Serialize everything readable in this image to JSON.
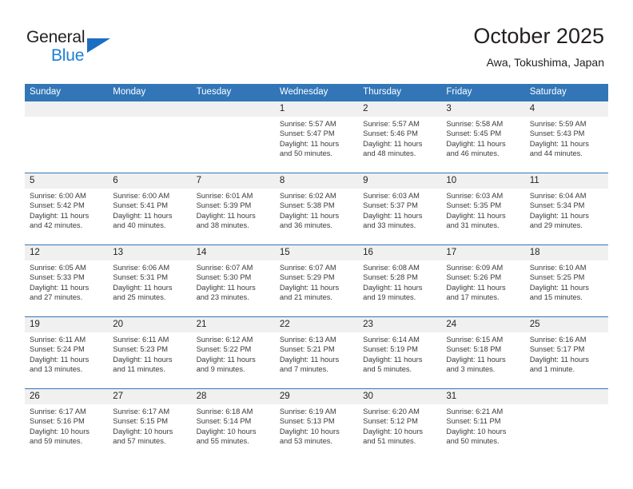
{
  "brand": {
    "name_top": "General",
    "name_bottom": "Blue",
    "triangle_icon": "brand-triangle-icon",
    "color_dark": "#231f20",
    "color_blue": "#1b7fd4"
  },
  "header": {
    "title": "October 2025",
    "subtitle": "Awa, Tokushima, Japan"
  },
  "theme": {
    "header_bg": "#3276b8",
    "date_band_bg": "#f0f0f0",
    "divider": "#3276b8",
    "text": "#231f20"
  },
  "calendar": {
    "weekdays": [
      "Sunday",
      "Monday",
      "Tuesday",
      "Wednesday",
      "Thursday",
      "Friday",
      "Saturday"
    ],
    "weeks": [
      [
        {
          "day": "",
          "sunrise": "",
          "sunset": "",
          "daylight_line1": "",
          "daylight_line2": ""
        },
        {
          "day": "",
          "sunrise": "",
          "sunset": "",
          "daylight_line1": "",
          "daylight_line2": ""
        },
        {
          "day": "",
          "sunrise": "",
          "sunset": "",
          "daylight_line1": "",
          "daylight_line2": ""
        },
        {
          "day": "1",
          "sunrise": "Sunrise: 5:57 AM",
          "sunset": "Sunset: 5:47 PM",
          "daylight_line1": "Daylight: 11 hours",
          "daylight_line2": "and 50 minutes."
        },
        {
          "day": "2",
          "sunrise": "Sunrise: 5:57 AM",
          "sunset": "Sunset: 5:46 PM",
          "daylight_line1": "Daylight: 11 hours",
          "daylight_line2": "and 48 minutes."
        },
        {
          "day": "3",
          "sunrise": "Sunrise: 5:58 AM",
          "sunset": "Sunset: 5:45 PM",
          "daylight_line1": "Daylight: 11 hours",
          "daylight_line2": "and 46 minutes."
        },
        {
          "day": "4",
          "sunrise": "Sunrise: 5:59 AM",
          "sunset": "Sunset: 5:43 PM",
          "daylight_line1": "Daylight: 11 hours",
          "daylight_line2": "and 44 minutes."
        }
      ],
      [
        {
          "day": "5",
          "sunrise": "Sunrise: 6:00 AM",
          "sunset": "Sunset: 5:42 PM",
          "daylight_line1": "Daylight: 11 hours",
          "daylight_line2": "and 42 minutes."
        },
        {
          "day": "6",
          "sunrise": "Sunrise: 6:00 AM",
          "sunset": "Sunset: 5:41 PM",
          "daylight_line1": "Daylight: 11 hours",
          "daylight_line2": "and 40 minutes."
        },
        {
          "day": "7",
          "sunrise": "Sunrise: 6:01 AM",
          "sunset": "Sunset: 5:39 PM",
          "daylight_line1": "Daylight: 11 hours",
          "daylight_line2": "and 38 minutes."
        },
        {
          "day": "8",
          "sunrise": "Sunrise: 6:02 AM",
          "sunset": "Sunset: 5:38 PM",
          "daylight_line1": "Daylight: 11 hours",
          "daylight_line2": "and 36 minutes."
        },
        {
          "day": "9",
          "sunrise": "Sunrise: 6:03 AM",
          "sunset": "Sunset: 5:37 PM",
          "daylight_line1": "Daylight: 11 hours",
          "daylight_line2": "and 33 minutes."
        },
        {
          "day": "10",
          "sunrise": "Sunrise: 6:03 AM",
          "sunset": "Sunset: 5:35 PM",
          "daylight_line1": "Daylight: 11 hours",
          "daylight_line2": "and 31 minutes."
        },
        {
          "day": "11",
          "sunrise": "Sunrise: 6:04 AM",
          "sunset": "Sunset: 5:34 PM",
          "daylight_line1": "Daylight: 11 hours",
          "daylight_line2": "and 29 minutes."
        }
      ],
      [
        {
          "day": "12",
          "sunrise": "Sunrise: 6:05 AM",
          "sunset": "Sunset: 5:33 PM",
          "daylight_line1": "Daylight: 11 hours",
          "daylight_line2": "and 27 minutes."
        },
        {
          "day": "13",
          "sunrise": "Sunrise: 6:06 AM",
          "sunset": "Sunset: 5:31 PM",
          "daylight_line1": "Daylight: 11 hours",
          "daylight_line2": "and 25 minutes."
        },
        {
          "day": "14",
          "sunrise": "Sunrise: 6:07 AM",
          "sunset": "Sunset: 5:30 PM",
          "daylight_line1": "Daylight: 11 hours",
          "daylight_line2": "and 23 minutes."
        },
        {
          "day": "15",
          "sunrise": "Sunrise: 6:07 AM",
          "sunset": "Sunset: 5:29 PM",
          "daylight_line1": "Daylight: 11 hours",
          "daylight_line2": "and 21 minutes."
        },
        {
          "day": "16",
          "sunrise": "Sunrise: 6:08 AM",
          "sunset": "Sunset: 5:28 PM",
          "daylight_line1": "Daylight: 11 hours",
          "daylight_line2": "and 19 minutes."
        },
        {
          "day": "17",
          "sunrise": "Sunrise: 6:09 AM",
          "sunset": "Sunset: 5:26 PM",
          "daylight_line1": "Daylight: 11 hours",
          "daylight_line2": "and 17 minutes."
        },
        {
          "day": "18",
          "sunrise": "Sunrise: 6:10 AM",
          "sunset": "Sunset: 5:25 PM",
          "daylight_line1": "Daylight: 11 hours",
          "daylight_line2": "and 15 minutes."
        }
      ],
      [
        {
          "day": "19",
          "sunrise": "Sunrise: 6:11 AM",
          "sunset": "Sunset: 5:24 PM",
          "daylight_line1": "Daylight: 11 hours",
          "daylight_line2": "and 13 minutes."
        },
        {
          "day": "20",
          "sunrise": "Sunrise: 6:11 AM",
          "sunset": "Sunset: 5:23 PM",
          "daylight_line1": "Daylight: 11 hours",
          "daylight_line2": "and 11 minutes."
        },
        {
          "day": "21",
          "sunrise": "Sunrise: 6:12 AM",
          "sunset": "Sunset: 5:22 PM",
          "daylight_line1": "Daylight: 11 hours",
          "daylight_line2": "and 9 minutes."
        },
        {
          "day": "22",
          "sunrise": "Sunrise: 6:13 AM",
          "sunset": "Sunset: 5:21 PM",
          "daylight_line1": "Daylight: 11 hours",
          "daylight_line2": "and 7 minutes."
        },
        {
          "day": "23",
          "sunrise": "Sunrise: 6:14 AM",
          "sunset": "Sunset: 5:19 PM",
          "daylight_line1": "Daylight: 11 hours",
          "daylight_line2": "and 5 minutes."
        },
        {
          "day": "24",
          "sunrise": "Sunrise: 6:15 AM",
          "sunset": "Sunset: 5:18 PM",
          "daylight_line1": "Daylight: 11 hours",
          "daylight_line2": "and 3 minutes."
        },
        {
          "day": "25",
          "sunrise": "Sunrise: 6:16 AM",
          "sunset": "Sunset: 5:17 PM",
          "daylight_line1": "Daylight: 11 hours",
          "daylight_line2": "and 1 minute."
        }
      ],
      [
        {
          "day": "26",
          "sunrise": "Sunrise: 6:17 AM",
          "sunset": "Sunset: 5:16 PM",
          "daylight_line1": "Daylight: 10 hours",
          "daylight_line2": "and 59 minutes."
        },
        {
          "day": "27",
          "sunrise": "Sunrise: 6:17 AM",
          "sunset": "Sunset: 5:15 PM",
          "daylight_line1": "Daylight: 10 hours",
          "daylight_line2": "and 57 minutes."
        },
        {
          "day": "28",
          "sunrise": "Sunrise: 6:18 AM",
          "sunset": "Sunset: 5:14 PM",
          "daylight_line1": "Daylight: 10 hours",
          "daylight_line2": "and 55 minutes."
        },
        {
          "day": "29",
          "sunrise": "Sunrise: 6:19 AM",
          "sunset": "Sunset: 5:13 PM",
          "daylight_line1": "Daylight: 10 hours",
          "daylight_line2": "and 53 minutes."
        },
        {
          "day": "30",
          "sunrise": "Sunrise: 6:20 AM",
          "sunset": "Sunset: 5:12 PM",
          "daylight_line1": "Daylight: 10 hours",
          "daylight_line2": "and 51 minutes."
        },
        {
          "day": "31",
          "sunrise": "Sunrise: 6:21 AM",
          "sunset": "Sunset: 5:11 PM",
          "daylight_line1": "Daylight: 10 hours",
          "daylight_line2": "and 50 minutes."
        },
        {
          "day": "",
          "sunrise": "",
          "sunset": "",
          "daylight_line1": "",
          "daylight_line2": ""
        }
      ]
    ]
  }
}
